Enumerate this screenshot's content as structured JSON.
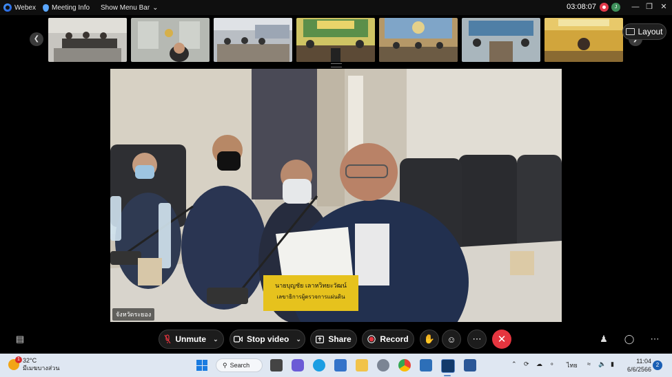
{
  "titlebar": {
    "app_name": "Webex",
    "meeting_info": "Meeting Info",
    "show_menu_bar": "Show Menu Bar",
    "timer": "03:08:07",
    "avatar_initial": "J"
  },
  "thumbnails": [
    {
      "bg": "#6b6e73"
    },
    {
      "bg": "#8a8d8b"
    },
    {
      "bg": "#7b7f86"
    },
    {
      "bg": "#a9a35c"
    },
    {
      "bg": "#8f7b55"
    },
    {
      "bg": "#7d8f95"
    },
    {
      "bg": "#b59a4b"
    }
  ],
  "layout_label": "Layout",
  "main_video": {
    "participant_label": "จังหวัดระยอง",
    "nameplate_line1": "นายบุญชัย เลาหวิทยะวัฒน์",
    "nameplate_line2": "เลขาธิการผู้ตรวจการแผ่นดิน"
  },
  "controls": {
    "unmute": "Unmute",
    "stop_video": "Stop video",
    "share": "Share",
    "record": "Record"
  },
  "taskbar": {
    "temperature": "32°C",
    "weather_desc": "มีเมฆบางส่วน",
    "weather_badge": "1",
    "search": "Search",
    "language": "ไทย",
    "time": "11:04",
    "date": "6/6/2566",
    "notifications": "2"
  },
  "colors": {
    "leave": "#e5353f",
    "record_dot": "#e5353f",
    "accent": "#1a7be0"
  }
}
